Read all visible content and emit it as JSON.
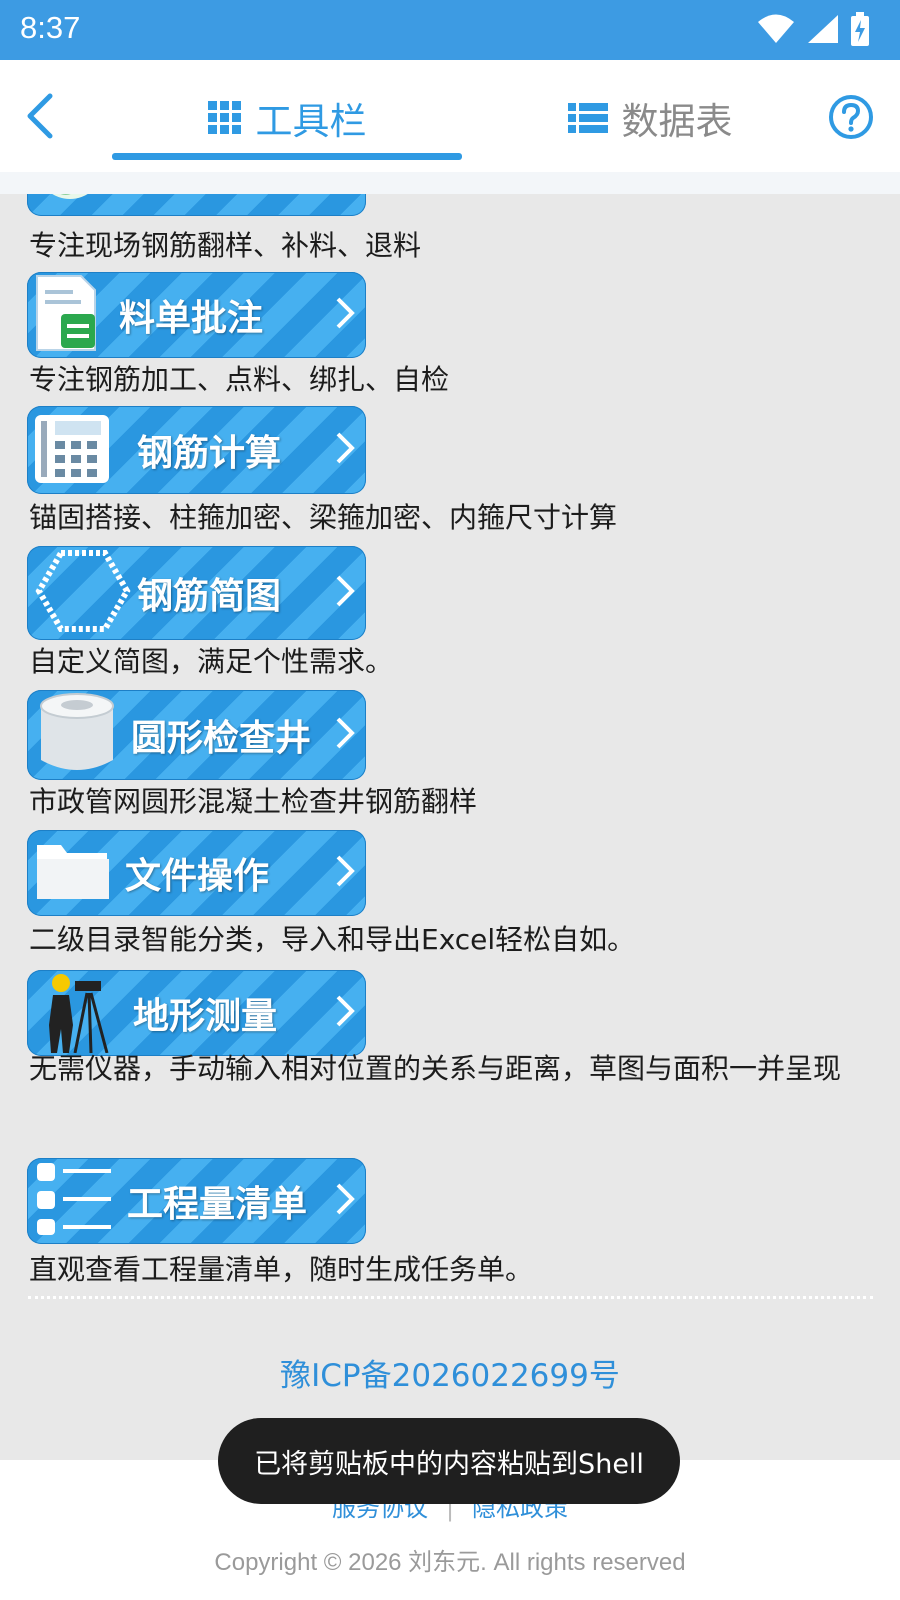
{
  "status_bar": {
    "time": "8:37"
  },
  "header": {
    "tabs": [
      {
        "label": "工具栏",
        "active": true
      },
      {
        "label": "数据表",
        "active": false
      }
    ]
  },
  "tools": [
    {
      "label": "",
      "description": "专注现场钢筋翻样、补料、退料"
    },
    {
      "label": "料单批注",
      "description": "专注钢筋加工、点料、绑扎、自检"
    },
    {
      "label": "钢筋计算",
      "description": "锚固搭接、柱箍加密、梁箍加密、内箍尺寸计算"
    },
    {
      "label": "钢筋简图",
      "description": "自定义简图，满足个性需求。"
    },
    {
      "label": "圆形检查井",
      "description": "市政管网圆形混凝土检查井钢筋翻样"
    },
    {
      "label": "文件操作",
      "description": "二级目录智能分类，导入和导出Excel轻松自如。"
    },
    {
      "label": "地形测量",
      "description": "无需仪器，手动输入相对位置的关系与距离，草图与面积一并呈现"
    },
    {
      "label": "工程量清单",
      "description": "直观查看工程量清单，随时生成任务单。"
    }
  ],
  "footer": {
    "icp": "豫ICP备2026022699号",
    "links": [
      "服务协议",
      "隐私政策"
    ],
    "copyright": "Copyright © 2026 刘东元. All rights reserved"
  },
  "toast": {
    "message": "已将剪贴板中的内容粘贴到Shell"
  },
  "colors": {
    "accent": "#2f9ae3",
    "status_bar": "#3d9be3",
    "toast_bg": "#1f1f1f"
  }
}
